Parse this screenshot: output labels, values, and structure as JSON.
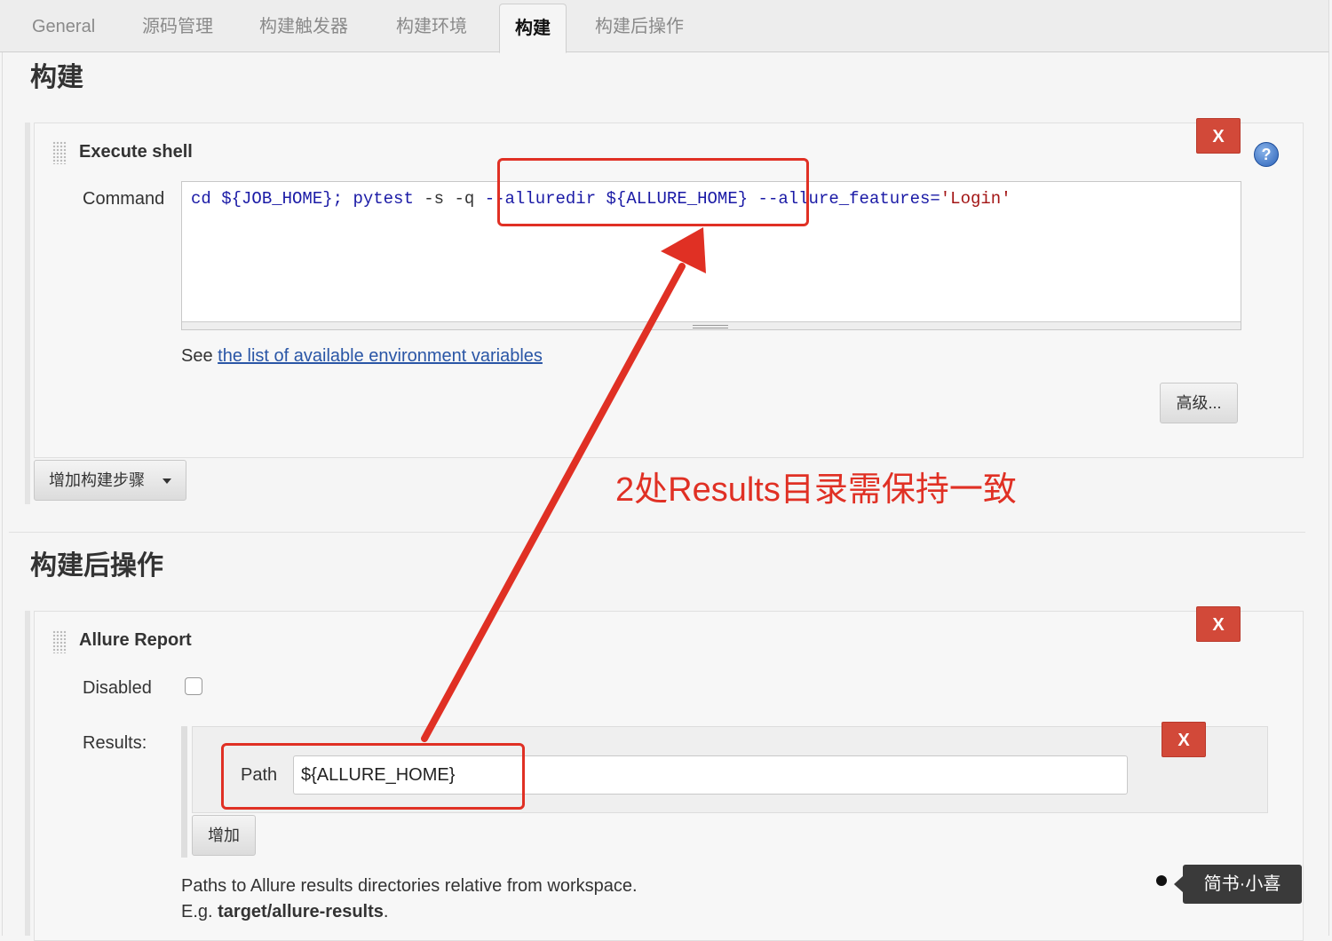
{
  "tabs": [
    "General",
    "源码管理",
    "构建触发器",
    "构建环境",
    "构建",
    "构建后操作"
  ],
  "active_tab": "构建",
  "build_section": {
    "title": "构建",
    "step": {
      "title": "Execute shell",
      "delete_label": "X",
      "command_label": "Command",
      "command_parts": {
        "p1": "cd ",
        "p2": "${JOB_HOME}; pytest ",
        "p3": "-s -q ",
        "p4": "--alluredir ${ALLURE_HOME} --allure_features=",
        "p5": "'Login'"
      },
      "see_text": "See ",
      "see_link": "the list of available environment variables",
      "advanced_label": "高级..."
    },
    "add_step_label": "增加构建步骤"
  },
  "annotation_text": "2处Results目录需保持一致",
  "post_section": {
    "title": "构建后操作",
    "allure": {
      "title": "Allure Report",
      "delete_label": "X",
      "disabled_label": "Disabled",
      "results_label": "Results:",
      "path_label": "Path",
      "path_value": "${ALLURE_HOME}",
      "path_delete_label": "X",
      "add_label": "增加",
      "help_line1": "Paths to Allure results directories relative from workspace.",
      "help_line2_prefix": "E.g. ",
      "help_line2_bold": "target/allure-results",
      "help_line2_suffix": "."
    }
  },
  "watermark": "简书·小喜",
  "colors": {
    "accent_red": "#e03024",
    "delete_button": "#d24939",
    "link": "#2a56a6"
  }
}
